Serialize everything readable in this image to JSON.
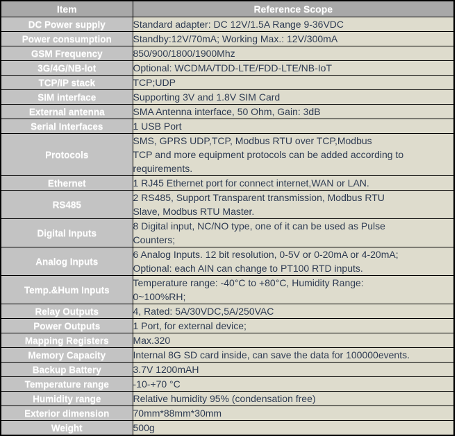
{
  "table": {
    "headers": {
      "item": "Item",
      "scope": "Reference Scope"
    },
    "rows": [
      {
        "item": "DC Power supply",
        "lines": [
          "Standard adapter: DC 12V/1.5A  Range 9-36VDC"
        ]
      },
      {
        "item": "Power consumption",
        "lines": [
          "Standby:12V/70mA;  Working Max.: 12V/300mA"
        ]
      },
      {
        "item": "GSM Frequency",
        "lines": [
          "850/900/1800/1900Mhz"
        ]
      },
      {
        "item": "3G/4G/NB-lot",
        "lines": [
          "Optional: WCDMA/TDD-LTE/FDD-LTE/NB-IoT"
        ]
      },
      {
        "item": "TCP/IP stack",
        "lines": [
          "TCP;UDP"
        ]
      },
      {
        "item": "SIM interface",
        "lines": [
          "Supporting 3V and 1.8V SIM Card"
        ]
      },
      {
        "item": "External antenna",
        "lines": [
          "SMA Antenna interface, 50 Ohm, Gain: 3dB"
        ]
      },
      {
        "item": "Serial Interfaces",
        "lines": [
          "1 USB Port"
        ]
      },
      {
        "item": "Protocols",
        "lines": [
          "SMS, GPRS UDP,TCP, Modbus RTU over TCP,Modbus",
          "TCP and more equipment protocols can be added according to",
          "requirements."
        ]
      },
      {
        "item": "Ethernet",
        "lines": [
          "1 RJ45 Ethernet port for connect internet,WAN or LAN."
        ]
      },
      {
        "item": "RS485",
        "lines": [
          "2 RS485, Support Transparent transmission, Modbus RTU",
          "Slave, Modbus RTU Master."
        ]
      },
      {
        "item": "Digital Inputs",
        "lines": [
          "8 Digital input, NC/NO type, one of it can be used as Pulse",
          "Counters;"
        ]
      },
      {
        "item": "Analog Inputs",
        "lines": [
          "6 Analog Inputs. 12 bit resolution, 0-5V or 0-20mA or 4-20mA;",
          "Optional: each AIN can change to PT100 RTD inputs."
        ]
      },
      {
        "item": "Temp.&Hum Inputs",
        "lines": [
          "Temperature range: -40°C to +80°C, Humidity Range:",
          "0~100%RH;"
        ]
      },
      {
        "item": "Relay Outputs",
        "lines": [
          "4, Rated: 5A/30VDC,5A/250VAC"
        ]
      },
      {
        "item": "Power Outputs",
        "lines": [
          "1 Port, for external device;"
        ]
      },
      {
        "item": "Mapping Registers",
        "lines": [
          "Max.320"
        ]
      },
      {
        "item": "Memory Capacity",
        "lines": [
          "Internal 8G SD card inside, can save the data for 100000events."
        ]
      },
      {
        "item": "Backup Battery",
        "lines": [
          "3.7V 1200mAH"
        ]
      },
      {
        "item": "Temperature range",
        "lines": [
          "-10-+70 °C"
        ]
      },
      {
        "item": "Humidity range",
        "lines": [
          "Relative humidity 95% (condensation free)"
        ]
      },
      {
        "item": "Exterior dimension",
        "lines": [
          "70mm*88mm*30mm"
        ]
      },
      {
        "item": "Weight",
        "lines": [
          "500g"
        ]
      }
    ]
  },
  "colors": {
    "header_bg": "#a8a8a8",
    "item_bg": "#c3c3c3",
    "scope_bg": "#dedccd",
    "scope_text": "#2e3b52",
    "label_text": "#ffffff",
    "border": "#000000",
    "page_bg": "#ffffff"
  }
}
